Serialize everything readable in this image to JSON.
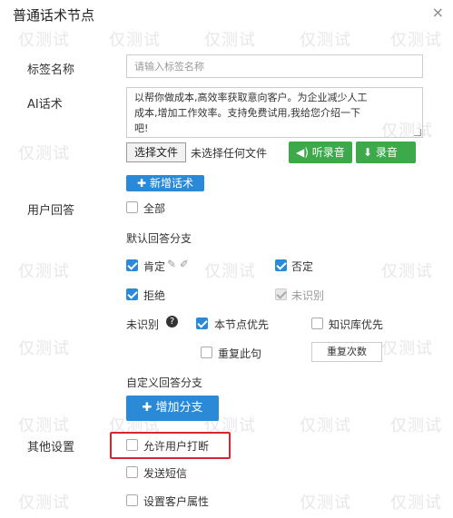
{
  "dialog": {
    "title": "普通话术节点",
    "close_label": "×"
  },
  "form": {
    "tag_name": {
      "label": "标签名称",
      "placeholder": "请输入标签名称"
    },
    "ai_script": {
      "label": "AI话术",
      "value_line1": "以帮你做成本,高效率获取意向客户。为企业减少人工",
      "value_line2": "成本,增加工作效率。支持免费试用,我给您介绍一下",
      "value_line3": "吧!"
    },
    "file": {
      "button": "选择文件",
      "status": "未选择任何文件"
    },
    "listen_button": "听录音",
    "record_button": "录音",
    "add_script_button": "新增话术"
  },
  "user_reply": {
    "label": "用户回答",
    "all_label": "全部",
    "default_branch_label": "默认回答分支",
    "options": {
      "affirm": "肯定",
      "deny": "否定",
      "reject": "拒绝",
      "unknown": "未识别"
    },
    "unrecognized_label": "未识别",
    "help_icon": "?",
    "node_first_label": "本节点优先",
    "kb_first_label": "知识库优先",
    "repeat_label": "重复此句",
    "repeat_count_placeholder": "重复次数",
    "custom_branch_label": "自定义回答分支",
    "add_branch_button": "增加分支"
  },
  "other": {
    "label": "其他设置",
    "allow_interrupt": "允许用户打断",
    "send_sms": "发送短信",
    "set_attr": "设置客户属性"
  },
  "watermark": "仅测试",
  "colors": {
    "green": "#3da94a",
    "blue": "#2b8ad8",
    "red": "#d8262c"
  }
}
